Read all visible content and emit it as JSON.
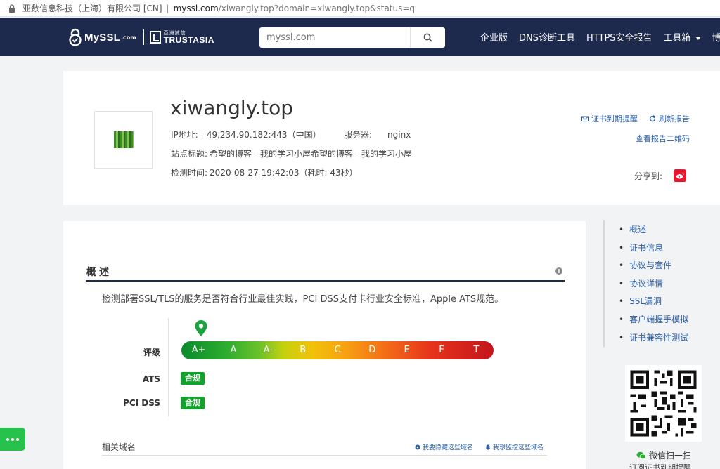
{
  "browser": {
    "site_name": "亚数信息科技（上海）有限公司 [CN]",
    "separator": "|",
    "url_domain": "myssl.com",
    "url_path": "/xiwangly.top?domain=xiwangly.top&status=q"
  },
  "header": {
    "logo_myssl": "MySSL",
    "logo_com": ".com",
    "logo_trustasia_cn": "亞洲誠信",
    "logo_trustasia_en": "TRUSTASIA",
    "search_placeholder": "myssl.com",
    "menu": [
      "企业版",
      "DNS诊断工具",
      "HTTPS安全报告",
      "工具箱",
      "博客"
    ]
  },
  "summary": {
    "domain": "xiwangly.top",
    "ip_label": "IP地址:",
    "ip_value": "49.234.90.182:443（中国）",
    "server_label": "服务器:",
    "server_value": "nginx",
    "site_title_label": "站点标题:",
    "site_title_value": "希望的博客 - 我的学习小屋希望的博客 - 我的学习小屋",
    "time_label": "检测时间:",
    "time_value": "2020-08-27 19:42:03（耗时: 43秒）",
    "cert_reminder": "证书到期提醒",
    "refresh": "刷新报告",
    "qr_report": "查看报告二维码",
    "share_label": "分享到:"
  },
  "overview": {
    "title": "概述",
    "description": "检测部署SSL/TLS的服务是否符合行业最佳实践，PCI DSS支付卡行业安全标准，Apple ATS规范。",
    "grade_label": "评级",
    "grades": [
      "A+",
      "A",
      "A-",
      "B",
      "C",
      "D",
      "E",
      "F",
      "T"
    ],
    "current_grade": "A+",
    "ats_label": "ATS",
    "ats_status": "合规",
    "pci_label": "PCI DSS",
    "pci_status": "合规",
    "related_title": "相关域名",
    "hide_domain": "我要隐藏这些域名",
    "monitor_domain": "我想监控这些域名",
    "colors": {
      "nav": "#1d2a4d",
      "compliant": "#12a32b",
      "link": "#2a5ea8"
    }
  },
  "side_nav": {
    "items": [
      "概述",
      "证书信息",
      "协议与套件",
      "协议详情",
      "SSL漏洞",
      "客户端握手模拟",
      "证书兼容性测试"
    ],
    "wechat_scan": "微信扫一扫",
    "wechat_sub": "订阅证书到期提醒"
  }
}
